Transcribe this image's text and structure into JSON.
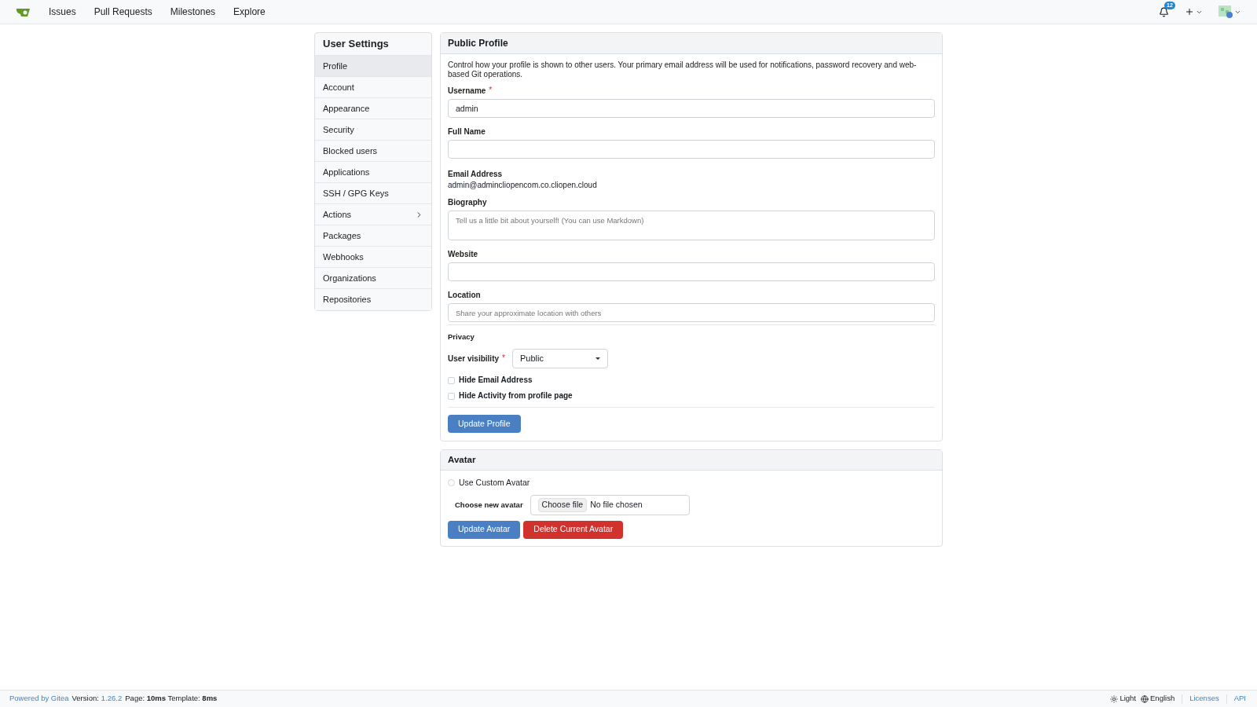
{
  "navbar": {
    "items": [
      {
        "label": "Issues"
      },
      {
        "label": "Pull Requests"
      },
      {
        "label": "Milestones"
      },
      {
        "label": "Explore"
      }
    ],
    "notification_count": "12"
  },
  "sidebar": {
    "title": "User Settings",
    "items": [
      {
        "label": "Profile",
        "selected": true,
        "expandable": false
      },
      {
        "label": "Account",
        "selected": false,
        "expandable": false
      },
      {
        "label": "Appearance",
        "selected": false,
        "expandable": false
      },
      {
        "label": "Security",
        "selected": false,
        "expandable": false
      },
      {
        "label": "Blocked users",
        "selected": false,
        "expandable": false
      },
      {
        "label": "Applications",
        "selected": false,
        "expandable": false
      },
      {
        "label": "SSH / GPG Keys",
        "selected": false,
        "expandable": false
      },
      {
        "label": "Actions",
        "selected": false,
        "expandable": true
      },
      {
        "label": "Packages",
        "selected": false,
        "expandable": false
      },
      {
        "label": "Webhooks",
        "selected": false,
        "expandable": false
      },
      {
        "label": "Organizations",
        "selected": false,
        "expandable": false
      },
      {
        "label": "Repositories",
        "selected": false,
        "expandable": false
      }
    ]
  },
  "public_profile": {
    "title": "Public Profile",
    "description": "Control how your profile is shown to other users. Your primary email address will be used for notifications, password recovery and web-based Git operations.",
    "username": {
      "label": "Username",
      "required_mark": "*",
      "value": "admin"
    },
    "full_name": {
      "label": "Full Name"
    },
    "email": {
      "label": "Email Address",
      "value": "admin@admincliopencom.co.cliopen.cloud"
    },
    "biography": {
      "label": "Biography",
      "placeholder": "Tell us a little bit about yourself! (You can use Markdown)"
    },
    "website": {
      "label": "Website"
    },
    "location": {
      "label": "Location",
      "placeholder": "Share your approximate location with others"
    },
    "privacy": {
      "title": "Privacy",
      "visibility_label": "User visibility",
      "visibility_required_mark": "*",
      "visibility_value": "Public",
      "checkboxes": [
        {
          "label": "Hide Email Address",
          "checked": false
        },
        {
          "label": "Hide Activity from profile page",
          "checked": false
        }
      ]
    },
    "submit": "Update Profile"
  },
  "avatar": {
    "title": "Avatar",
    "use_custom": {
      "label": "Use Custom Avatar",
      "selected": false
    },
    "file_label": "Choose new avatar",
    "file_button": "Choose file",
    "file_status": "No file chosen",
    "update": "Update Avatar",
    "delete": "Delete Current Avatar"
  },
  "footer": {
    "powered": "Powered by Gitea",
    "version_label": "Version:",
    "version": "1.26.2",
    "timing": "Page: **10ms** Template: **8ms**",
    "theme": "Light",
    "language": "English",
    "licenses": "Licenses",
    "api": "API"
  }
}
